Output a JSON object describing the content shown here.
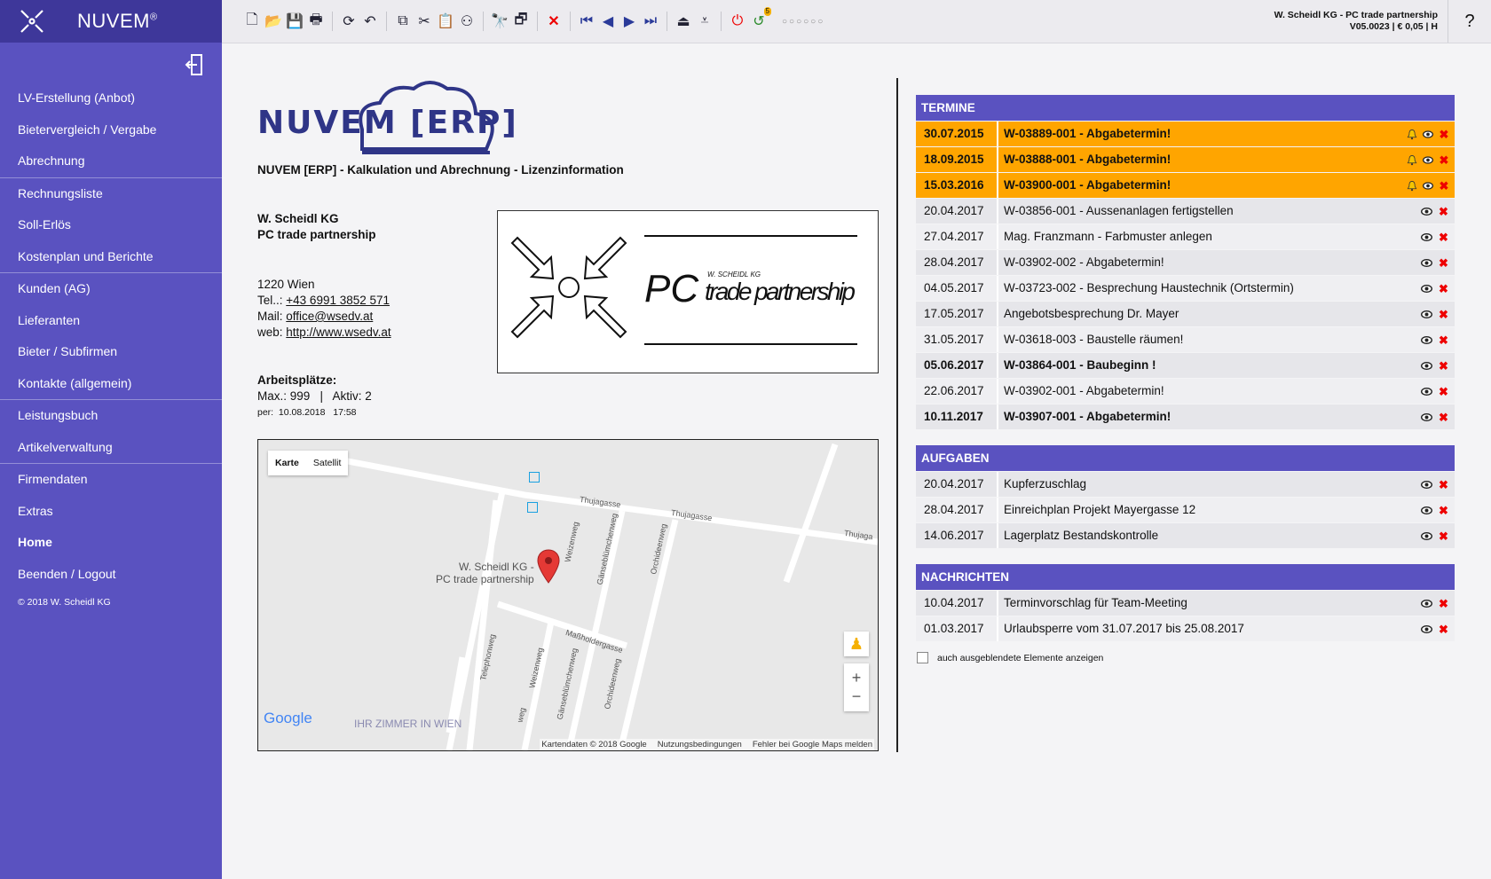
{
  "sidebar": {
    "brand": "NUVEM",
    "brand_mark": "®",
    "items": [
      {
        "label": "LV-Erstellung (Anbot)"
      },
      {
        "label": "Bietervergleich / Vergabe"
      },
      {
        "label": "Abrechnung"
      },
      {
        "label": "Rechnungsliste"
      },
      {
        "label": "Soll-Erlös"
      },
      {
        "label": "Kostenplan und Berichte"
      },
      {
        "label": "Kunden (AG)"
      },
      {
        "label": "Lieferanten"
      },
      {
        "label": "Bieter / Subfirmen"
      },
      {
        "label": "Kontakte (allgemein)"
      },
      {
        "label": "Leistungsbuch"
      },
      {
        "label": "Artikelverwaltung"
      },
      {
        "label": "Firmendaten"
      },
      {
        "label": "Extras"
      },
      {
        "label": "Home"
      },
      {
        "label": "Beenden / Logout"
      }
    ],
    "copyright": "© 2018 W. Scheidl KG"
  },
  "toolbar": {
    "info_line1": "W. Scheidl KG - PC trade partnership",
    "info_line2": "V05.0023 | € 0,05 | H",
    "help": "?",
    "badge": "5",
    "dots": "○○○○○○"
  },
  "main": {
    "logo_text": "NUVEM [ERP]",
    "subtitle": "NUVEM [ERP] - Kalkulation und Abrechnung - Lizenzinformation",
    "company_line1": "W. Scheidl KG",
    "company_line2": "PC trade partnership",
    "city": "1220 Wien",
    "tel_label": "Tel..:",
    "tel": "+43 6991 3852 571",
    "mail_label": "Mail:",
    "mail": "office@wsedv.at",
    "web_label": "web:",
    "web": "http://www.wsedv.at",
    "seats_title": "Arbeitsplätze:",
    "seats_line": "Max.: 999   |   Aktiv: 2",
    "seats_date": "per:  10.08.2018   17:58",
    "pc_logo_big": "PC",
    "pc_logo_small": "W. SCHEIDL KG",
    "pc_logo_tagline": "trade partnership"
  },
  "map": {
    "tab_map": "Karte",
    "tab_sat": "Satellit",
    "marker_label1": "W. Scheidl KG -",
    "marker_label2": "PC trade partnership",
    "streets": [
      "Thujagasse",
      "Thujagasse",
      "Thujaga",
      "Weizenweg",
      "Gänseblümchenweg",
      "Orchideenweg",
      "Maßholdergasse",
      "Telephonweg",
      "Weizenweg",
      "Gänseblümchenweg",
      "Orchideenweg",
      "weg"
    ],
    "poi": "IHR ZIMMER IN WIEN",
    "google": "Google",
    "footer": [
      "Kartendaten © 2018 Google",
      "Nutzungsbedingungen",
      "Fehler bei Google Maps melden"
    ]
  },
  "termine": {
    "title": "TERMINE",
    "rows": [
      {
        "date": "30.07.2015",
        "text": "W-03889-001 - Abgabetermin!",
        "style": "hl",
        "bell": true
      },
      {
        "date": "18.09.2015",
        "text": "W-03888-001 - Abgabetermin!",
        "style": "hl",
        "bell": true
      },
      {
        "date": "15.03.2016",
        "text": "W-03900-001 - Abgabetermin!",
        "style": "hl",
        "bell": true
      },
      {
        "date": "20.04.2017",
        "text": "W-03856-001 - Aussenanlagen fertigstellen",
        "style": ""
      },
      {
        "date": "27.04.2017",
        "text": "Mag. Franzmann - Farbmuster anlegen",
        "style": "alt"
      },
      {
        "date": "28.04.2017",
        "text": "W-03902-002 - Abgabetermin!",
        "style": ""
      },
      {
        "date": "04.05.2017",
        "text": "W-03723-002 - Besprechung Haustechnik (Ortstermin)",
        "style": "alt"
      },
      {
        "date": "17.05.2017",
        "text": "Angebotsbesprechung Dr. Mayer",
        "style": ""
      },
      {
        "date": "31.05.2017",
        "text": "W-03618-003 - Baustelle räumen!",
        "style": "alt"
      },
      {
        "date": "05.06.2017",
        "text": "W-03864-001 - Baubeginn !",
        "style": "bold"
      },
      {
        "date": "22.06.2017",
        "text": "W-03902-001 - Abgabetermin!",
        "style": "alt"
      },
      {
        "date": "10.11.2017",
        "text": "W-03907-001 - Abgabetermin!",
        "style": "bold"
      }
    ]
  },
  "aufgaben": {
    "title": "AUFGABEN",
    "rows": [
      {
        "date": "20.04.2017",
        "text": "Kupferzuschlag",
        "style": ""
      },
      {
        "date": "28.04.2017",
        "text": "Einreichplan Projekt Mayergasse 12",
        "style": "alt"
      },
      {
        "date": "14.06.2017",
        "text": "Lagerplatz Bestandskontrolle",
        "style": ""
      }
    ]
  },
  "nachrichten": {
    "title": "NACHRICHTEN",
    "rows": [
      {
        "date": "10.04.2017",
        "text": "Terminvorschlag für Team-Meeting",
        "style": ""
      },
      {
        "date": "01.03.2017",
        "text": "Urlaubsperre vom 31.07.2017 bis 25.08.2017",
        "style": "alt"
      }
    ]
  },
  "show_hidden_label": "auch ausgeblendete Elemente anzeigen",
  "colors": {
    "accent": "#5a52c0",
    "highlight": "#ffa500",
    "delete": "#e00000"
  }
}
